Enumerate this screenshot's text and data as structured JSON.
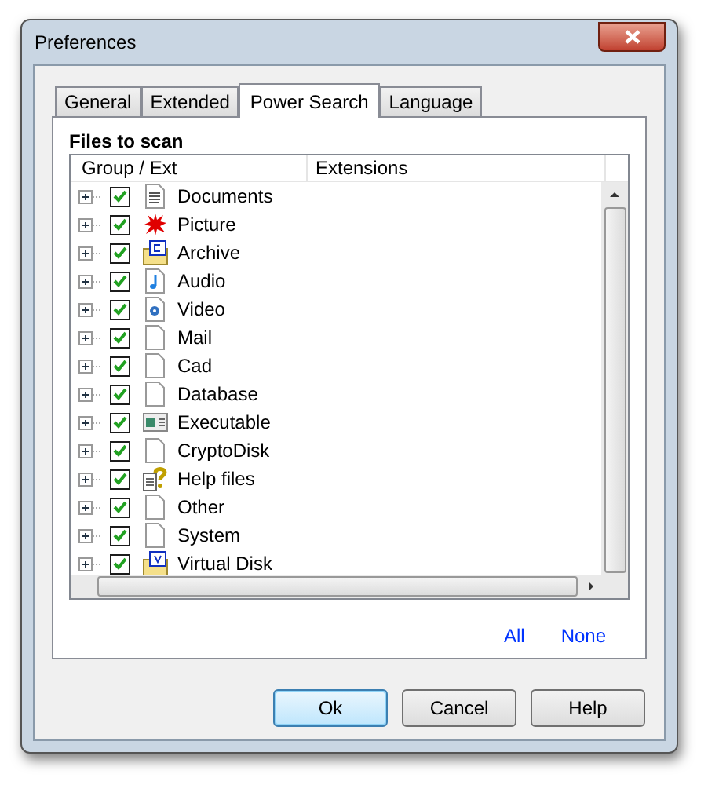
{
  "window": {
    "title": "Preferences"
  },
  "tabs": [
    {
      "label": "General",
      "selected": false
    },
    {
      "label": "Extended",
      "selected": false
    },
    {
      "label": "Power Search",
      "selected": true
    },
    {
      "label": "Language",
      "selected": false
    }
  ],
  "section_title": "Files to scan",
  "table": {
    "columns": [
      "Group / Ext",
      "Extensions"
    ],
    "rows": [
      {
        "name": "Documents",
        "checked": true,
        "kind": "document"
      },
      {
        "name": "Picture",
        "checked": true,
        "kind": "splat"
      },
      {
        "name": "Archive",
        "checked": true,
        "kind": "archive"
      },
      {
        "name": "Audio",
        "checked": true,
        "kind": "audio"
      },
      {
        "name": "Video",
        "checked": true,
        "kind": "video"
      },
      {
        "name": "Mail",
        "checked": true,
        "kind": "blank"
      },
      {
        "name": "Cad",
        "checked": true,
        "kind": "blank"
      },
      {
        "name": "Database",
        "checked": true,
        "kind": "blank"
      },
      {
        "name": "Executable",
        "checked": true,
        "kind": "executable"
      },
      {
        "name": "CryptoDisk",
        "checked": true,
        "kind": "blank"
      },
      {
        "name": "Help files",
        "checked": true,
        "kind": "help"
      },
      {
        "name": "Other",
        "checked": true,
        "kind": "blank"
      },
      {
        "name": "System",
        "checked": true,
        "kind": "blank"
      },
      {
        "name": "Virtual Disk",
        "checked": true,
        "kind": "disk"
      }
    ]
  },
  "links": [
    "All",
    "None"
  ],
  "buttons": [
    {
      "label": "Ok",
      "selected": true
    },
    {
      "label": "Cancel",
      "selected": false
    },
    {
      "label": "Help",
      "selected": false
    }
  ]
}
